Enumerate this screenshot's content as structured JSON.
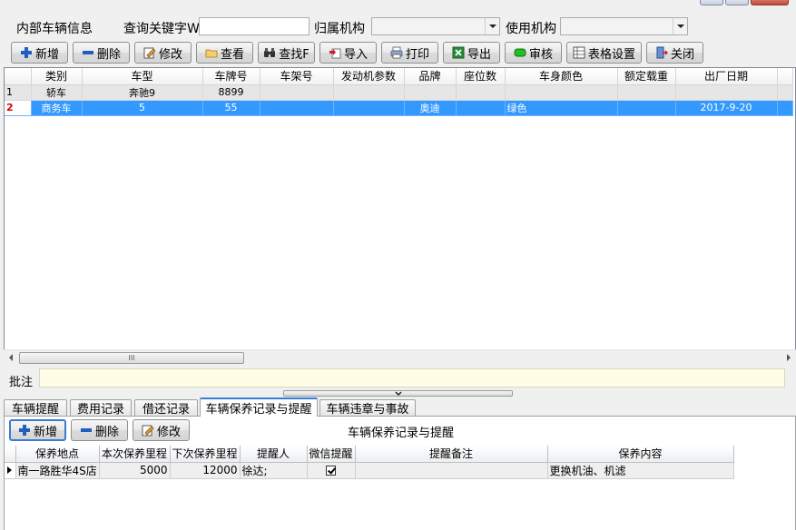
{
  "header": {
    "title": "内部车辆信息",
    "search_label": "查询关键字W",
    "search_value": "",
    "owner_org_label": "归属机构",
    "owner_org_value": "",
    "use_org_label": "使用机构",
    "use_org_value": ""
  },
  "toolbar": {
    "add": "新增",
    "delete": "删除",
    "edit": "修改",
    "view": "查看",
    "find": "查找F",
    "import": "导入",
    "print": "打印",
    "export": "导出",
    "audit": "审核",
    "table_settings": "表格设置",
    "close": "关闭"
  },
  "grid": {
    "columns": [
      "类别",
      "车型",
      "车牌号",
      "车架号",
      "发动机参数",
      "品牌",
      "座位数",
      "车身颜色",
      "额定载重",
      "出厂日期"
    ],
    "rows": [
      {
        "num": "1",
        "cells": [
          "轿车",
          "奔驰9",
          "8899",
          "",
          "",
          "",
          "",
          "",
          "",
          ""
        ]
      },
      {
        "num": "2",
        "cells": [
          "商务车",
          "5",
          "55",
          "",
          "",
          "奥迪",
          "",
          "绿色",
          "",
          "2017-9-20"
        ]
      }
    ],
    "scroll_mark": "III"
  },
  "remark": {
    "label": "批注",
    "value": ""
  },
  "tabs": [
    "车辆提醒",
    "费用记录",
    "借还记录",
    "车辆保养记录与提醒",
    "车辆违章与事故"
  ],
  "active_tab": 3,
  "panel": {
    "title": "车辆保养记录与提醒",
    "add": "新增",
    "delete": "删除",
    "edit": "修改",
    "columns": [
      "保养地点",
      "本次保养里程",
      "下次保养里程",
      "提醒人",
      "微信提醒",
      "提醒备注",
      "保养内容"
    ],
    "rows": [
      {
        "cells": [
          "南一路胜华4S店",
          "5000",
          "12000",
          "徐达;",
          "",
          "",
          "更换机油、机滤"
        ],
        "wechat": true
      }
    ]
  }
}
